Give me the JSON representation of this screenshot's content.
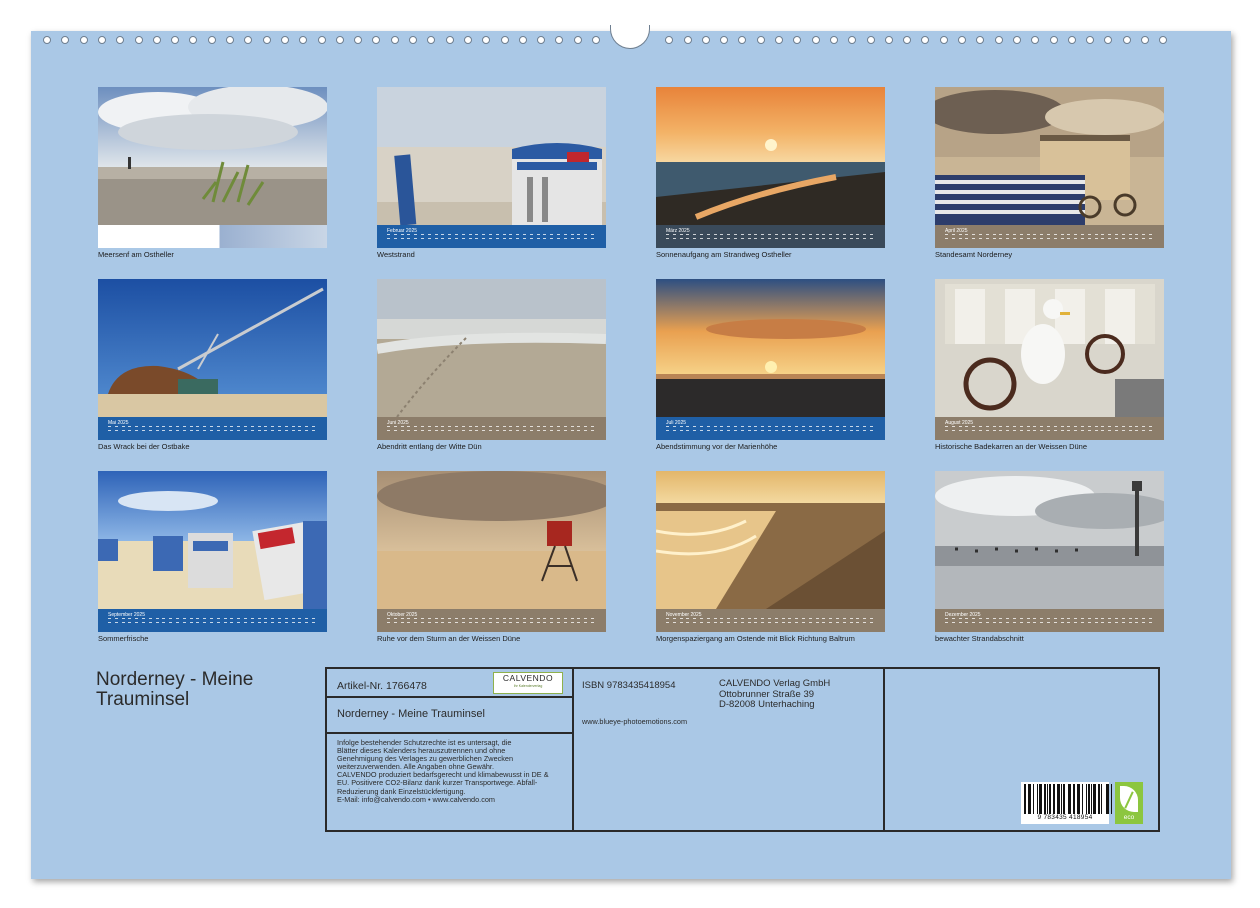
{
  "calendar": {
    "title": "Norderney - Meine Trauminsel",
    "colors": {
      "sheet": "#aac8e6",
      "strip_blue": "#1f5fa6",
      "strip_beige": "#8c7d6a"
    },
    "months": [
      {
        "caption": "Meersenf am Ostheller",
        "month_label": "",
        "strip": "none"
      },
      {
        "caption": "Weststrand",
        "month_label": "Februar 2025",
        "strip": "blue"
      },
      {
        "caption": "Sonnenaufgang am Strandweg Ostheller",
        "month_label": "März 2025",
        "strip": "dark"
      },
      {
        "caption": "Standesamt Norderney",
        "month_label": "April 2025",
        "strip": "beige"
      },
      {
        "caption": "Das Wrack bei der Ostbake",
        "month_label": "Mai 2025",
        "strip": "blue"
      },
      {
        "caption": "Abendritt entlang der Witte Dün",
        "month_label": "Juni 2025",
        "strip": "beige"
      },
      {
        "caption": "Abendstimmung vor der Marienhöhe",
        "month_label": "Juli 2025",
        "strip": "blue"
      },
      {
        "caption": "Historische Badekarren an der Weissen Düne",
        "month_label": "August 2025",
        "strip": "beige"
      },
      {
        "caption": "Sommerfrische",
        "month_label": "September 2025",
        "strip": "blue"
      },
      {
        "caption": "Ruhe vor dem Sturm an der Weissen Düne",
        "month_label": "Oktober 2025",
        "strip": "beige"
      },
      {
        "caption": "Morgenspaziergang am Ostende mit Blick Richtung Baltrum",
        "month_label": "November 2025",
        "strip": "beige"
      },
      {
        "caption": "bewachter Strandabschnitt",
        "month_label": "Dezember 2025",
        "strip": "beige"
      }
    ]
  },
  "info_box": {
    "article_no": "Artikel-Nr. 1766478",
    "product_title": "Norderney - Meine Trauminsel",
    "logo": {
      "wordmark": "CALVENDO",
      "tagline": "Ihr Kalenderverlag"
    },
    "legal_lines": [
      "Infolge bestehender Schutzrechte ist es untersagt, die",
      "Blätter dieses Kalenders herauszutrennen und ohne",
      "Genehmigung des Verlages zu gewerblichen Zwecken",
      "weiterzuverwenden. Alle Angaben ohne Gewähr.",
      "CALVENDO produziert bedarfsgerecht und klimabewusst in DE &",
      "EU. Positivere CO2-Bilanz dank kurzer Transportwege. Abfall-",
      "Reduzierung dank Einzelstückfertigung.",
      "E-Mail: info@calvendo.com • www.calvendo.com"
    ],
    "isbn": "ISBN 9783435418954",
    "publisher_lines": [
      "CALVENDO Verlag GmbH",
      "Ottobrunner Straße 39",
      "D-82008 Unterhaching"
    ],
    "website": "www.blueye-photoemotions.com",
    "barcode_number": "9 783435 418954",
    "eco_label": "eco"
  }
}
